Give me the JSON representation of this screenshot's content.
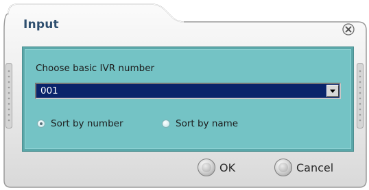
{
  "dialog": {
    "title": "Input",
    "label": "Choose basic IVR number",
    "select": {
      "value": "001"
    },
    "radios": {
      "by_number": {
        "label": "Sort by number",
        "checked": true
      },
      "by_name": {
        "label": "Sort by name",
        "checked": false
      }
    },
    "buttons": {
      "ok": "OK",
      "cancel": "Cancel"
    }
  },
  "colors": {
    "panel": "#74c3c5",
    "select_bg": "#0a246a",
    "title": "#2f4f6f"
  }
}
